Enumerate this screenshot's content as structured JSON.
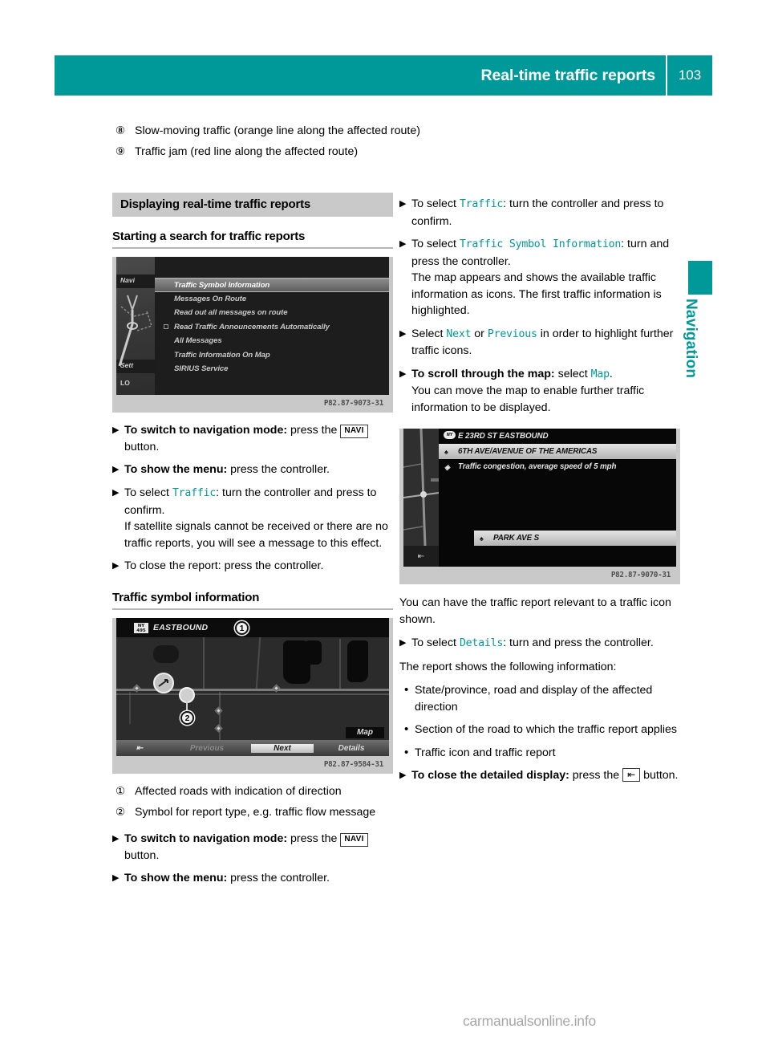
{
  "header": {
    "title": "Real-time traffic reports",
    "page_number": "103",
    "accent_color": "#00999A"
  },
  "side_tab": {
    "label": "Navigation",
    "color": "#00999A"
  },
  "legend": [
    {
      "marker": "⑧",
      "text": "Slow-moving traffic (orange line along the affected route)"
    },
    {
      "marker": "⑨",
      "text": "Traffic jam (red line along the affected route)"
    }
  ],
  "left_column": {
    "band_heading": "Displaying real-time traffic reports",
    "sub_heading_1": "Starting a search for traffic reports",
    "figure_1": {
      "caption_code": "P82.87-9073-31",
      "sidebar_labels": [
        "Navi",
        "Sett",
        "LO"
      ],
      "menu_items": [
        {
          "label": "Traffic Symbol Information",
          "selected": true,
          "checkbox": false
        },
        {
          "label": "Messages On Route",
          "selected": false,
          "checkbox": false
        },
        {
          "label": "Read out all messages on route",
          "selected": false,
          "checkbox": false
        },
        {
          "label": "Read Traffic Announcements Automatically",
          "selected": false,
          "checkbox": true
        },
        {
          "label": "All Messages",
          "selected": false,
          "checkbox": false
        },
        {
          "label": "Traffic Information On Map",
          "selected": false,
          "checkbox": false
        },
        {
          "label": "SIRIUS Service",
          "selected": false,
          "checkbox": false
        }
      ]
    },
    "steps_1": [
      {
        "bold": "To switch to navigation mode:",
        "text": " press the ",
        "keycap": "NAVI",
        "tail": " button."
      },
      {
        "bold": "To show the menu:",
        "text": " press the controller."
      },
      {
        "text_pre": "To select ",
        "cmd": "Traffic",
        "text_post": ": turn the controller and press to confirm.",
        "extra": "If satellite signals cannot be received or there are no traffic reports, you will see a message to this effect."
      },
      {
        "text": "To close the report: press the controller."
      }
    ],
    "sub_heading_2": "Traffic symbol information",
    "figure_2": {
      "caption_code": "P82.87-9584-31",
      "top_label": "EASTBOUND",
      "badge_text": "NY 495",
      "markers": [
        "1",
        "2"
      ],
      "buttons": [
        {
          "label": "Previous",
          "state": "dim"
        },
        {
          "label": "Next",
          "state": "highlighted"
        },
        {
          "label": "Details",
          "state": "normal"
        },
        {
          "label": "Map",
          "state": "normal"
        }
      ]
    },
    "callouts": [
      {
        "marker": "①",
        "text": "Affected roads with indication of direction"
      },
      {
        "marker": "②",
        "text": "Symbol for report type, e.g. traffic flow message"
      }
    ],
    "steps_2": [
      {
        "bold": "To switch to navigation mode:",
        "text": " press the ",
        "keycap": "NAVI",
        "tail": " button."
      },
      {
        "bold": "To show the menu:",
        "text": " press the controller."
      }
    ]
  },
  "right_column": {
    "steps_1": [
      {
        "text_pre": "To select ",
        "cmd": "Traffic",
        "text_post": ": turn the controller and press to confirm."
      },
      {
        "text_pre": "To select ",
        "cmd": "Traffic Symbol Information",
        "text_post": ": turn and press the controller.",
        "extra": "The map appears and shows the available traffic information as icons. The first traffic information is highlighted."
      },
      {
        "text_pre": "Select ",
        "cmd": "Next",
        "mid": " or ",
        "cmd2": "Previous",
        "text_post": " in order to highlight further traffic icons."
      },
      {
        "bold": "To scroll through the map:",
        "text": " select ",
        "cmd": "Map",
        "text_post": ".",
        "extra": "You can move the map to enable further traffic information to be displayed."
      }
    ],
    "figure_3": {
      "caption_code": "P82.87-9070-31",
      "rows": [
        {
          "label": "E 23RD ST EASTBOUND",
          "icon": "overview-badge",
          "highlighted": false
        },
        {
          "label": "6TH AVE/AVENUE OF THE AMERICAS",
          "icon": "♠",
          "highlighted": true
        },
        {
          "label": "Traffic congestion, average speed of 5 mph",
          "icon": "◈",
          "highlighted": false
        },
        {
          "label": "PARK AVE S",
          "icon": "♠",
          "highlighted": true
        }
      ]
    },
    "para_1": "You can have the traffic report relevant to a traffic icon shown.",
    "step_details": {
      "text_pre": "To select ",
      "cmd": "Details",
      "text_post": ": turn and press the controller."
    },
    "para_2": "The report shows the following information:",
    "bullets": [
      "State/province, road and display of the affected direction",
      "Section of the road to which the traffic report applies",
      "Traffic icon and traffic report"
    ],
    "step_close": {
      "bold": "To close the detailed display:",
      "text": " press the ",
      "keycap_glyph": "⇤",
      "tail": " button."
    }
  },
  "watermark": "carmanualsonline.info"
}
